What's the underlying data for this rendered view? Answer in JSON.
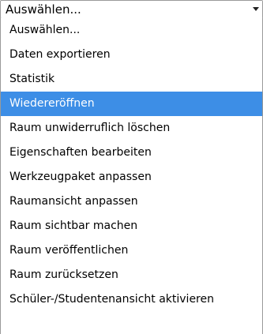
{
  "select": {
    "value": "Auswählen...",
    "arrow_icon": "caret-down-icon"
  },
  "options": [
    {
      "label": "Auswählen...",
      "selected": false
    },
    {
      "label": "Daten exportieren",
      "selected": false
    },
    {
      "label": "Statistik",
      "selected": false
    },
    {
      "label": "Wiedereröffnen",
      "selected": true
    },
    {
      "label": "Raum unwiderruflich löschen",
      "selected": false
    },
    {
      "label": "Eigenschaften bearbeiten",
      "selected": false
    },
    {
      "label": "Werkzeugpaket anpassen",
      "selected": false
    },
    {
      "label": "Raumansicht anpassen",
      "selected": false
    },
    {
      "label": "Raum sichtbar machen",
      "selected": false
    },
    {
      "label": "Raum veröffentlichen",
      "selected": false
    },
    {
      "label": "Raum zurücksetzen",
      "selected": false
    },
    {
      "label": "Schüler-/Studentenansicht aktivieren",
      "selected": false
    }
  ],
  "colors": {
    "highlight": "#3d8ee6",
    "border": "#9a9a9a"
  }
}
